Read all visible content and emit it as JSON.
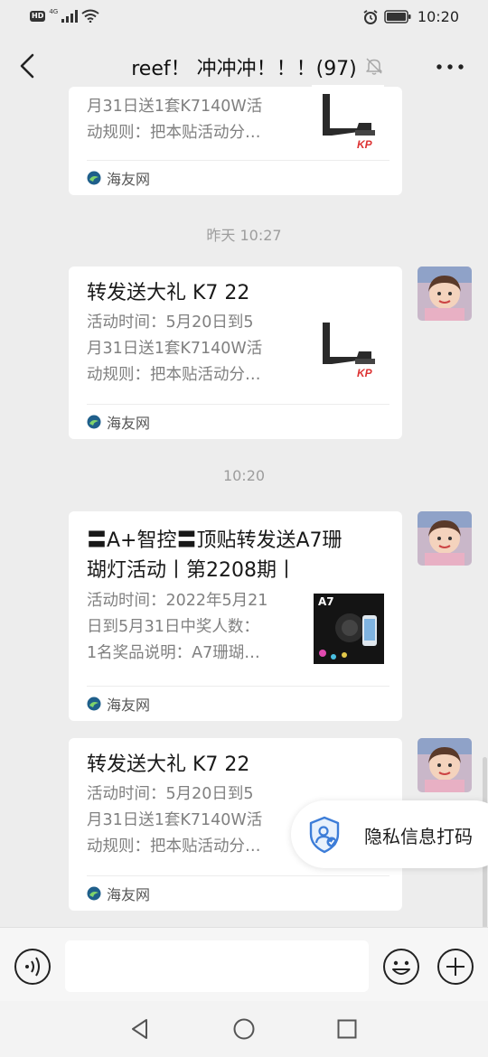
{
  "status_bar": {
    "badge": "HD",
    "network": "4G",
    "time": "10:20"
  },
  "header": {
    "title": "reef！ 冲冲冲！！！(97)"
  },
  "messages": [
    {
      "title": "",
      "desc": "月31日送1套K7140W活\n动规则：把本贴活动分…",
      "source": "海友网",
      "thumb_icon": "k7-lamp-thumbnail"
    },
    {
      "timestamp": "昨天 10:27",
      "title": "转发送大礼 K7 22",
      "desc": "活动时间：5月20日到5\n月31日送1套K7140W活\n动规则：把本贴活动分…",
      "source": "海友网",
      "thumb_icon": "k7-lamp-thumbnail"
    },
    {
      "timestamp": "10:20",
      "title": "〓A+智控〓顶贴转发送A7珊\n瑚灯活动丨第2208期丨",
      "desc": "活动时间：2022年5月21\n日到5月31日中奖人数：\n1名奖品说明：A7珊瑚…",
      "source": "海友网",
      "thumb_label": "A7",
      "thumb_icon": "a7-lamp-thumbnail"
    },
    {
      "title": "转发送大礼 K7 22",
      "desc": "活动时间：5月20日到5\n月31日送1套K7140W活\n动规则：把本贴活动分…",
      "source": "海友网",
      "thumb_icon": "k7-lamp-thumbnail"
    }
  ],
  "privacy_tip": {
    "label": "隐私信息打码",
    "icon": "shield-user-icon"
  },
  "input": {
    "placeholder": ""
  },
  "colors": {
    "background": "#ededed",
    "card": "#ffffff",
    "desc_text": "#808080",
    "timestamp": "#9d9d9d",
    "brand_blue": "#3d7dd8"
  }
}
